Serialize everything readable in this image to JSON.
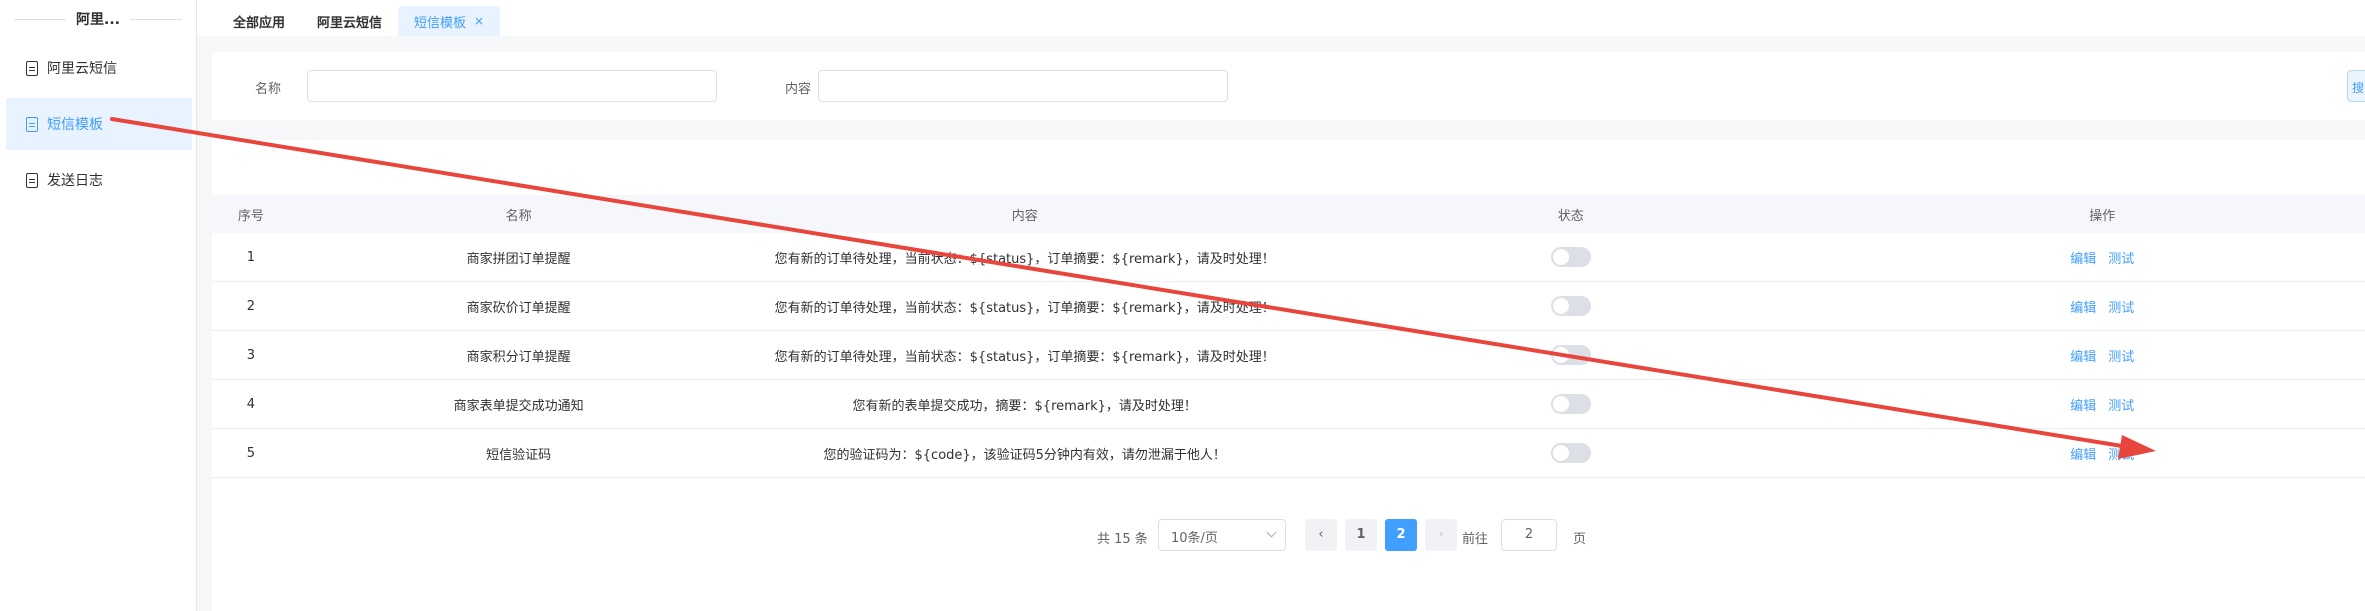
{
  "sidebar": {
    "title": "阿里...",
    "items": [
      {
        "label": "阿里云短信"
      },
      {
        "label": "短信模板"
      },
      {
        "label": "发送日志"
      }
    ]
  },
  "tabs": [
    {
      "label": "全部应用"
    },
    {
      "label": "阿里云短信"
    },
    {
      "label": "短信模板",
      "close": "×"
    }
  ],
  "filter": {
    "name_label": "名称",
    "content_label": "内容",
    "name_value": "",
    "content_value": "",
    "search_button": "搜"
  },
  "table": {
    "headers": [
      "序号",
      "名称",
      "内容",
      "状态",
      "操作"
    ],
    "rows": [
      {
        "idx": "1",
        "name": "商家拼团订单提醒",
        "content": "您有新的订单待处理，当前状态：${status}，订单摘要：${remark}，请及时处理！",
        "status": false,
        "edit": "编辑",
        "test": "测试"
      },
      {
        "idx": "2",
        "name": "商家砍价订单提醒",
        "content": "您有新的订单待处理，当前状态：${status}，订单摘要：${remark}，请及时处理！",
        "status": false,
        "edit": "编辑",
        "test": "测试"
      },
      {
        "idx": "3",
        "name": "商家积分订单提醒",
        "content": "您有新的订单待处理，当前状态：${status}，订单摘要：${remark}，请及时处理！",
        "status": false,
        "edit": "编辑",
        "test": "测试"
      },
      {
        "idx": "4",
        "name": "商家表单提交成功通知",
        "content": "您有新的表单提交成功，摘要：${remark}，请及时处理！",
        "status": false,
        "edit": "编辑",
        "test": "测试"
      },
      {
        "idx": "5",
        "name": "短信验证码",
        "content": "您的验证码为：${code}，该验证码5分钟内有效，请勿泄漏于他人！",
        "status": false,
        "edit": "编辑",
        "test": "测试"
      }
    ]
  },
  "pagination": {
    "total": "共 15 条",
    "page_size": "10条/页",
    "pages": [
      "1",
      "2"
    ],
    "current": "2",
    "goto_label": "前往",
    "goto_value": "2",
    "page_unit": "页",
    "prev_icon": "‹",
    "next_icon": "›"
  },
  "colors": {
    "accent": "#409eff",
    "annotation_arrow": "#e8453c"
  }
}
